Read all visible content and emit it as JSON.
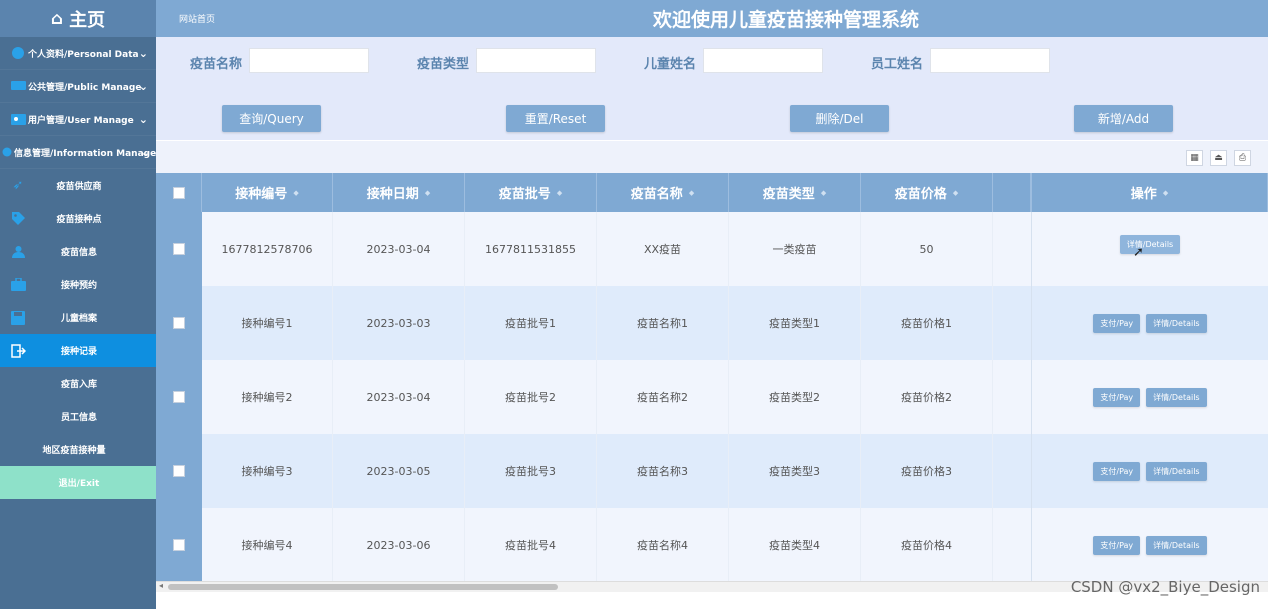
{
  "sidebar": {
    "home_label": "主页",
    "groups": [
      {
        "label": "个人资料/Personal Data"
      },
      {
        "label": "公共管理/Public Manage"
      },
      {
        "label": "用户管理/User Manage"
      },
      {
        "label": "信息管理/Information Manage"
      }
    ],
    "items": [
      {
        "label": "疫苗供应商",
        "icon": "rocket-icon"
      },
      {
        "label": "疫苗接种点",
        "icon": "tag-icon"
      },
      {
        "label": "疫苗信息",
        "icon": "users-icon"
      },
      {
        "label": "接种预约",
        "icon": "briefcase-icon"
      },
      {
        "label": "儿童档案",
        "icon": "save-icon"
      },
      {
        "label": "接种记录",
        "icon": "exit-icon"
      },
      {
        "label": "疫苗入库",
        "icon": ""
      },
      {
        "label": "员工信息",
        "icon": ""
      },
      {
        "label": "地区疫苗接种量",
        "icon": ""
      }
    ],
    "exit_label": "退出/Exit"
  },
  "header": {
    "breadcrumb": "网站首页",
    "title": "欢迎使用儿童疫苗接种管理系统"
  },
  "search": {
    "fields": [
      {
        "label": "疫苗名称",
        "value": ""
      },
      {
        "label": "疫苗类型",
        "value": ""
      },
      {
        "label": "儿童姓名",
        "value": ""
      },
      {
        "label": "员工姓名",
        "value": ""
      }
    ],
    "buttons": {
      "query": "查询/Query",
      "reset": "重置/Reset",
      "delete": "删除/Del",
      "add": "新增/Add"
    }
  },
  "table": {
    "columns": [
      "接种编号",
      "接种日期",
      "疫苗批号",
      "疫苗名称",
      "疫苗类型",
      "疫苗价格",
      "",
      "操作"
    ],
    "rows": [
      [
        "1677812578706",
        "2023-03-04",
        "1677811531855",
        "XX疫苗",
        "一类疫苗",
        "50"
      ],
      [
        "接种编号1",
        "2023-03-03",
        "疫苗批号1",
        "疫苗名称1",
        "疫苗类型1",
        "疫苗价格1"
      ],
      [
        "接种编号2",
        "2023-03-04",
        "疫苗批号2",
        "疫苗名称2",
        "疫苗类型2",
        "疫苗价格2"
      ],
      [
        "接种编号3",
        "2023-03-05",
        "疫苗批号3",
        "疫苗名称3",
        "疫苗类型3",
        "疫苗价格3"
      ],
      [
        "接种编号4",
        "2023-03-06",
        "疫苗批号4",
        "疫苗名称4",
        "疫苗类型4",
        "疫苗价格4"
      ]
    ],
    "pay_label": "支付/Pay",
    "details_label": "详情/Details",
    "details_hover_label": "详情/Details"
  },
  "watermark": "CSDN @vx2_Biye_Design",
  "colors": {
    "sidebar": "#4a6f93",
    "header": "#7fa9d3",
    "active": "#0e8fe0",
    "exit": "#8ee1c9",
    "search_bg": "#e3e9fa"
  }
}
